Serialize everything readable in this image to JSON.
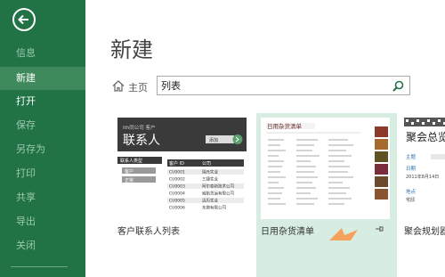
{
  "sidebar": {
    "items": [
      {
        "label": "信息"
      },
      {
        "label": "新建"
      },
      {
        "label": "打开"
      },
      {
        "label": "保存"
      },
      {
        "label": "另存为"
      },
      {
        "label": "打印"
      },
      {
        "label": "共享"
      },
      {
        "label": "导出"
      },
      {
        "label": "关闭"
      }
    ]
  },
  "main": {
    "title": "新建",
    "home_label": "主页",
    "search": {
      "value": "列表"
    }
  },
  "templates": [
    {
      "label": "客户联系人列表",
      "thumb": {
        "company": "Ith同公司 客户",
        "title": "联系人",
        "add_label": "添加",
        "filter_header": "联系人类型",
        "filter_items": [
          "客户",
          "正常"
        ],
        "col_id": "客户 ID",
        "col_company": "公司",
        "rows": [
          [
            "CU0001",
            "瑞元实业"
          ],
          [
            "CU0002",
            "三捷实业"
          ],
          [
            "CU0003",
            "阿尔泰新技术公司"
          ],
          [
            "CU0004",
            "威航货运有限公司"
          ],
          [
            "CU0005",
            "迈历实业"
          ],
          [
            "CU0006",
            "东旗有限公司"
          ]
        ]
      }
    },
    {
      "label": "日用杂货清单",
      "thumb": {
        "title": "日用杂货清单"
      }
    },
    {
      "label": "聚会规划器",
      "thumb": {
        "title": "聚会总览",
        "lines": [
          "主题",
          "日期",
          "2011年8月14日",
          "地点",
          "宅邸"
        ]
      }
    }
  ],
  "colors": {
    "sidebar": "#217346",
    "sidebar_active": "#3e8a5d",
    "card_selected_bg": "#d7ede1"
  }
}
